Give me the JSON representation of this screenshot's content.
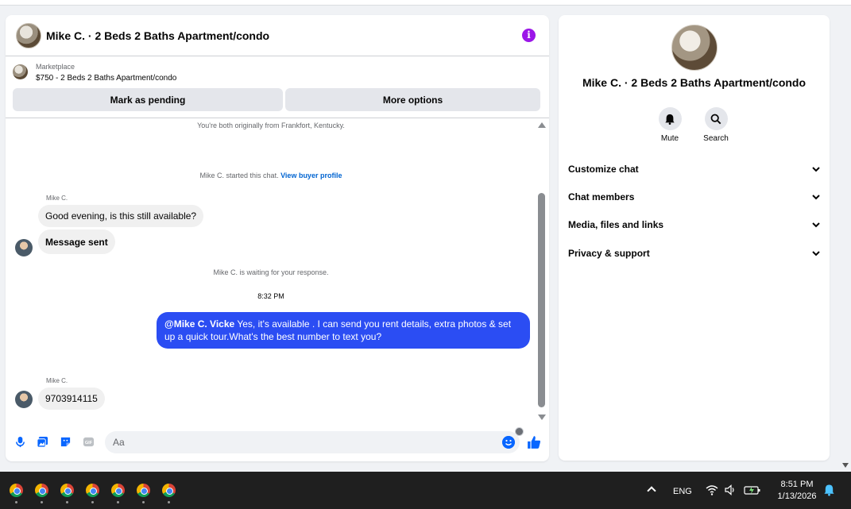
{
  "header": {
    "title": "Mike C. · 2 Beds 2 Baths Apartment/condo"
  },
  "listing": {
    "category": "Marketplace",
    "price_title": "$750 - 2 Beds 2 Baths Apartment/condo",
    "mark_pending_label": "Mark as pending",
    "more_options_label": "More options"
  },
  "messages": {
    "common_note": "You're both originally from Frankfort, Kentucky.",
    "started_note": "Mike C. started this chat.",
    "view_profile_link": "View buyer profile",
    "sender_name_1": "Mike C.",
    "msg_1": "Good evening, is this still available?",
    "msg_2": "Message sent",
    "waiting_note": "Mike C. is waiting for your response.",
    "timestamp": "8:32 PM",
    "reply_mention": "@Mike C. Vicke",
    "reply_text": " Yes, it's available .  I can send you rent details, extra photos & set up a quick tour.What's the best number to text you?",
    "sender_name_2": "Mike C.",
    "msg_3": "9703914115"
  },
  "composer": {
    "placeholder": "Aa"
  },
  "info_panel": {
    "name": "Mike C. · 2 Beds 2 Baths Apartment/condo",
    "mute_label": "Mute",
    "search_label": "Search",
    "sections": [
      "Customize chat",
      "Chat members",
      "Media, files and links",
      "Privacy & support"
    ]
  },
  "taskbar": {
    "language": "ENG",
    "time": "8:51 PM",
    "date": "1/13/2026",
    "app_icons": [
      "chrome-icon",
      "chrome-icon",
      "chrome-icon",
      "chrome-icon",
      "chrome-icon",
      "chrome-icon",
      "chrome-icon"
    ]
  },
  "colors": {
    "accent_blue": "#0866ff",
    "outgoing_bubble": "#2b4df3",
    "info_purple": "#9b16e8"
  }
}
